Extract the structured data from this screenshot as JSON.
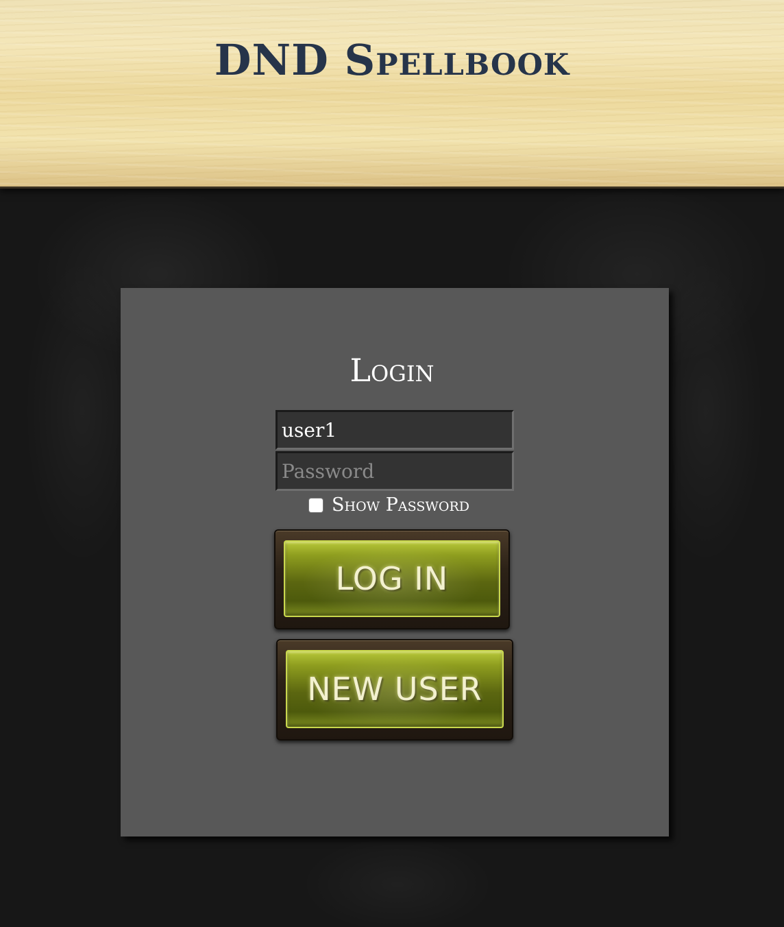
{
  "header": {
    "title": "DND Spellbook"
  },
  "login": {
    "title": "Login",
    "username": {
      "value": "user1",
      "placeholder": ""
    },
    "password": {
      "value": "",
      "placeholder": "Password"
    },
    "show_password": {
      "label": "Show Password",
      "checked": false
    },
    "login_button_label": "LOG IN",
    "new_user_button_label": "NEW USER"
  },
  "colors": {
    "header_title": "#26344a",
    "card_background": "#585858",
    "page_background": "#171717",
    "button_green": "#8f9e1f"
  }
}
